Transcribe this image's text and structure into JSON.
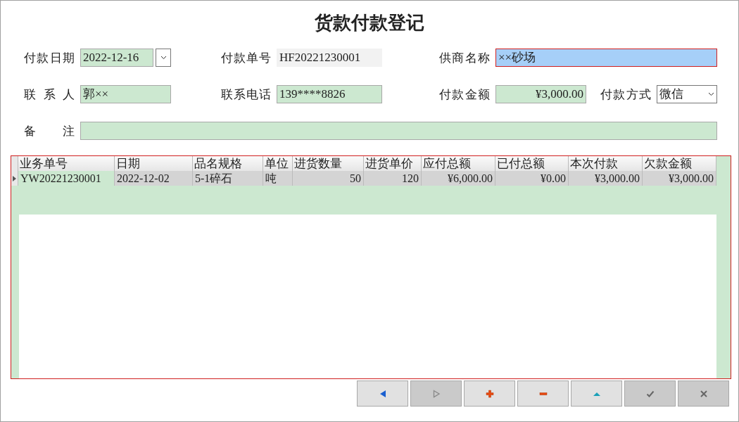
{
  "title": "货款付款登记",
  "fields": [
    {
      "label": "付款日期",
      "value": "2022-12-16",
      "kind": "date",
      "focused": false
    },
    {
      "label": "付款单号",
      "value": "HF20221230001",
      "kind": "readonly",
      "focused": false
    },
    {
      "label": "供商名称",
      "value": "××砂场",
      "kind": "text",
      "focused": true
    },
    {
      "label": "联 系 人",
      "value": "郭××",
      "kind": "text",
      "focused": false
    },
    {
      "label": "联系电话",
      "value": "139****8826",
      "kind": "text",
      "focused": false
    },
    {
      "label": "付款金额",
      "value": "¥3,000.00",
      "kind": "money",
      "focused": false
    },
    {
      "label": "付款方式",
      "value": "微信",
      "kind": "select",
      "focused": false
    },
    {
      "label": "备 注",
      "kind": "text",
      "focused": false
    }
  ],
  "table": {
    "columns": [
      "业务单号",
      "日期",
      "品名规格",
      "单位",
      "进货数量",
      "进货单价",
      "应付总额",
      "已付总额",
      "本次付款",
      "欠款金额"
    ],
    "rows": [
      {
        "selected": true,
        "cells": [
          "YW20221230001",
          "2022-12-02",
          "5-1碎石",
          "吨",
          "50",
          "120",
          "¥6,000.00",
          "¥0.00",
          "¥3,000.00",
          "¥3,000.00"
        ]
      }
    ]
  },
  "buttons": [
    {
      "kind": "prev",
      "disabled": false
    },
    {
      "kind": "next",
      "disabled": true
    },
    {
      "kind": "add",
      "disabled": false
    },
    {
      "kind": "delete",
      "disabled": false
    },
    {
      "kind": "up",
      "disabled": false
    },
    {
      "kind": "save",
      "disabled": true
    },
    {
      "kind": "cancel",
      "disabled": true
    }
  ]
}
